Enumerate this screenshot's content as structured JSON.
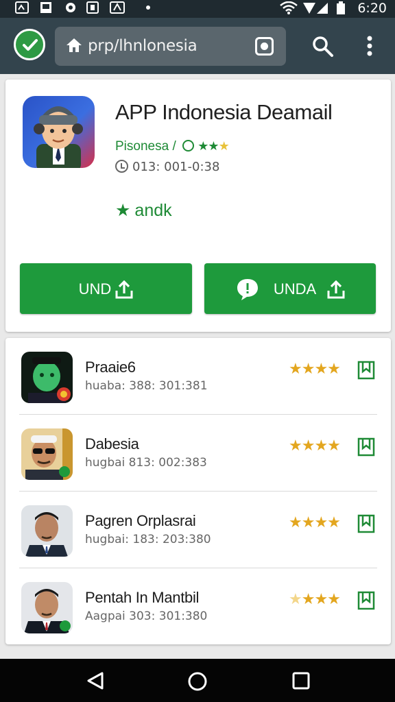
{
  "status_bar": {
    "time": "6:20",
    "icons": [
      "notification-icon",
      "image-icon",
      "record-icon",
      "sim-icon",
      "dot-icon",
      "wifi-icon",
      "signal-icon",
      "battery-icon"
    ]
  },
  "toolbar": {
    "url": "prp/lhnlonesia",
    "shield_color": "#2e9a44"
  },
  "app": {
    "title": "APP Indonesia Deamail",
    "developer": "Pisonesa /",
    "rating_stars": "★★",
    "rating_stars_dim": "★",
    "info": "013: 001-0:38",
    "badge": "andk",
    "accent": "#1e9a3c"
  },
  "buttons": [
    {
      "label": "UND"
    },
    {
      "label": "UNDA"
    }
  ],
  "list": [
    {
      "name": "Praaie6",
      "sub": "huaba: 388: 301:381",
      "stars_full": "★★★★",
      "stars_pale": ""
    },
    {
      "name": "Dabesia",
      "sub": "hugbai 813: 002:383",
      "stars_full": "★★★★",
      "stars_pale": ""
    },
    {
      "name": "Pagren Orplasrai",
      "sub": "hugbai: 183: 203:380",
      "stars_full": "★★★★",
      "stars_pale": ""
    },
    {
      "name": "Pentah In Mantbil",
      "sub": "Aagpai 303: 301:380",
      "stars_full": "★★★",
      "stars_pale": "★"
    }
  ]
}
